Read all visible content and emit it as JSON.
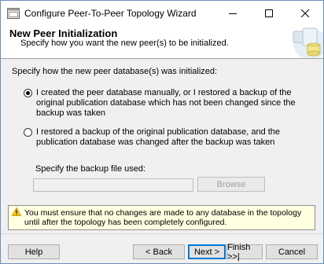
{
  "window": {
    "title": "Configure Peer-To-Peer Topology Wizard",
    "icons": {
      "app": "wizard-app-icon",
      "minimize": "minimize-icon",
      "maximize": "maximize-icon",
      "close": "close-icon"
    }
  },
  "header": {
    "title": "New Peer Initialization",
    "subtitle": "Specify how you want the new peer(s) to be initialized."
  },
  "content": {
    "prompt": "Specify how the new peer database(s) was initialized:",
    "options": [
      {
        "label": "I created the peer database manually, or I restored a backup of the original publication database which has not been changed since the backup was taken",
        "selected": true
      },
      {
        "label": "I restored a backup of the original publication database, and the publication database was changed after the backup was taken",
        "selected": false
      }
    ],
    "backup_label": "Specify the backup file used:",
    "backup_value": "",
    "browse_label": "Browse"
  },
  "warning": {
    "icon": "warning-icon",
    "text": "You must ensure that no changes are made to any database in the topology until after the topology has been completely configured."
  },
  "footer": {
    "help": "Help",
    "back": "< Back",
    "next": "Next >",
    "finish": "Finish >>|",
    "cancel": "Cancel"
  }
}
